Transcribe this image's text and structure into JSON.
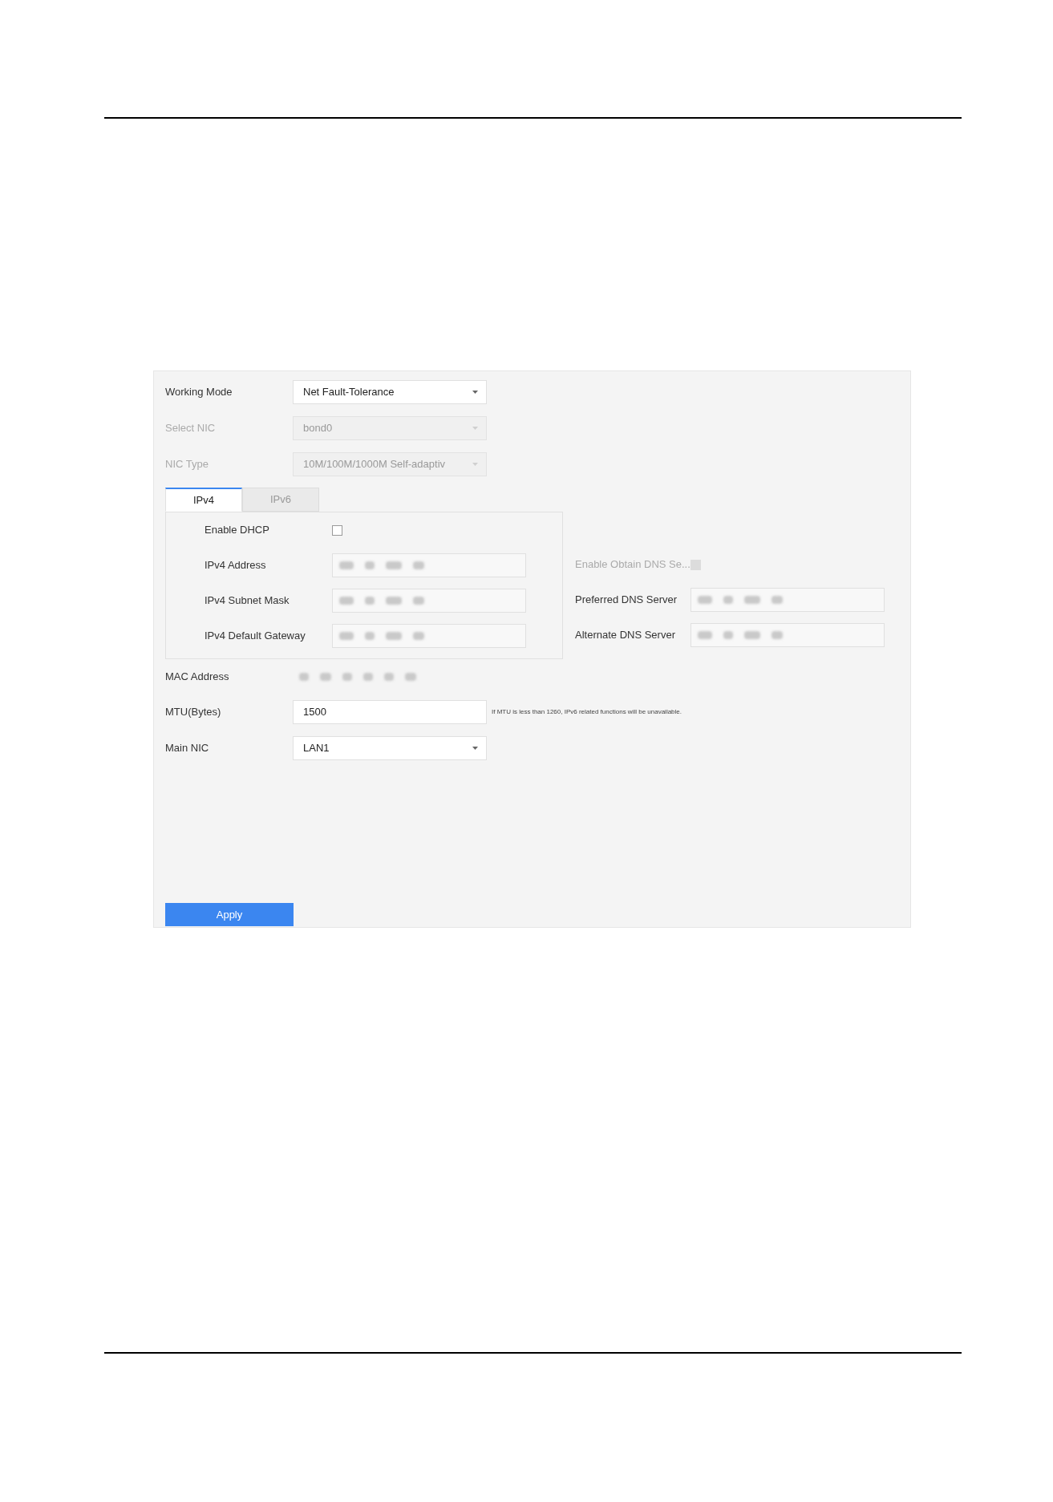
{
  "settings": {
    "top_rows": [
      {
        "kind": "dropdown",
        "label": "Working Mode",
        "value": "Net Fault-Tolerance",
        "disabled": false
      },
      {
        "kind": "dropdown",
        "label": "Select NIC",
        "value": "bond0",
        "disabled": true
      },
      {
        "kind": "dropdown",
        "label": "NIC Type",
        "value": "10M/100M/1000M Self-adaptiv",
        "disabled": true
      }
    ],
    "tabs": [
      {
        "label": "IPv4",
        "selected": true
      },
      {
        "label": "IPv6",
        "selected": false
      }
    ],
    "ip_rows": [
      {
        "kind": "checkbox",
        "label": "Enable DHCP",
        "checked": false
      },
      {
        "kind": "masked",
        "label": "IPv4 Address"
      },
      {
        "kind": "masked",
        "label": "IPv4 Subnet Mask"
      },
      {
        "kind": "masked",
        "label": "IPv4 Default Gateway"
      }
    ],
    "dns_rows": [
      {
        "kind": "checkbox",
        "label": "Enable Obtain DNS Se...",
        "disabled": true
      },
      {
        "kind": "masked",
        "label": "Preferred DNS Server"
      },
      {
        "kind": "masked",
        "label": "Alternate DNS Server"
      }
    ],
    "bottom_rows": [
      {
        "kind": "masked_text",
        "label": "MAC Address"
      },
      {
        "kind": "input",
        "label": "MTU(Bytes)",
        "value": "1500",
        "note": "If MTU is less than 1260, IPv6 related functions will be unavailable."
      },
      {
        "kind": "dropdown",
        "label": "Main NIC",
        "value": "LAN1",
        "disabled": false
      }
    ],
    "apply_button": "Apply"
  }
}
